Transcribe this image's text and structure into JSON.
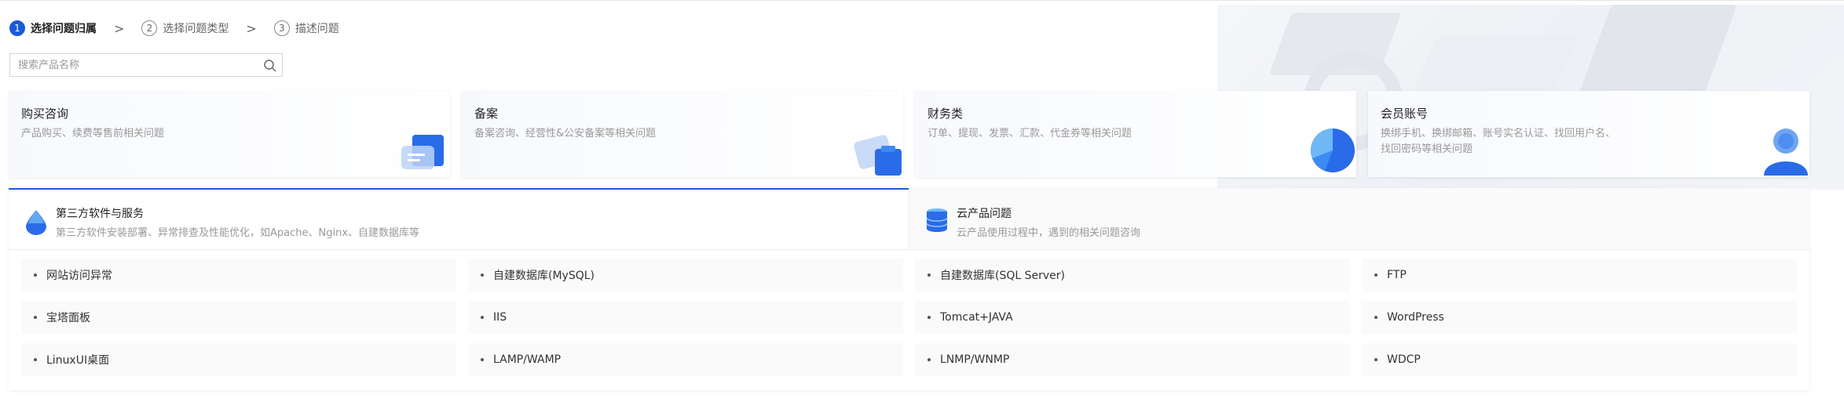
{
  "steps": [
    {
      "num": "1",
      "label": "选择问题归属",
      "active": true
    },
    {
      "num": "2",
      "label": "选择问题类型",
      "active": false
    },
    {
      "num": "3",
      "label": "描述问题",
      "active": false
    }
  ],
  "step_separator": ">",
  "search": {
    "placeholder": "搜索产品名称",
    "value": ""
  },
  "categories": [
    {
      "title": "购买咨询",
      "desc": "产品购买、续费等售前相关问题"
    },
    {
      "title": "备案",
      "desc": "备案咨询、经营性&公安备案等相关问题"
    },
    {
      "title": "财务类",
      "desc": "订单、提现、发票、汇款、代金券等相关问题"
    },
    {
      "title": "会员账号",
      "desc": "换绑手机、换绑邮箱、账号实名认证、找回用户名、找回密码等相关问题"
    }
  ],
  "tabs": [
    {
      "title": "第三方软件与服务",
      "desc": "第三方软件安装部署、异常排查及性能优化，如Apache、Nginx、自建数据库等",
      "active": true
    },
    {
      "title": "云产品问题",
      "desc": "云产品使用过程中，遇到的相关问题咨询",
      "active": false
    }
  ],
  "items": [
    [
      "网站访问异常",
      "自建数据库(MySQL)",
      "自建数据库(SQL Server)",
      "FTP"
    ],
    [
      "宝塔面板",
      "IIS",
      "Tomcat+JAVA",
      "WordPress"
    ],
    [
      "LinuxUI桌面",
      "LAMP/WAMP",
      "LNMP/WNMP",
      "WDCP"
    ]
  ],
  "colors": {
    "accent": "#1a5bd6",
    "accent_light": "#3b8bf0"
  }
}
